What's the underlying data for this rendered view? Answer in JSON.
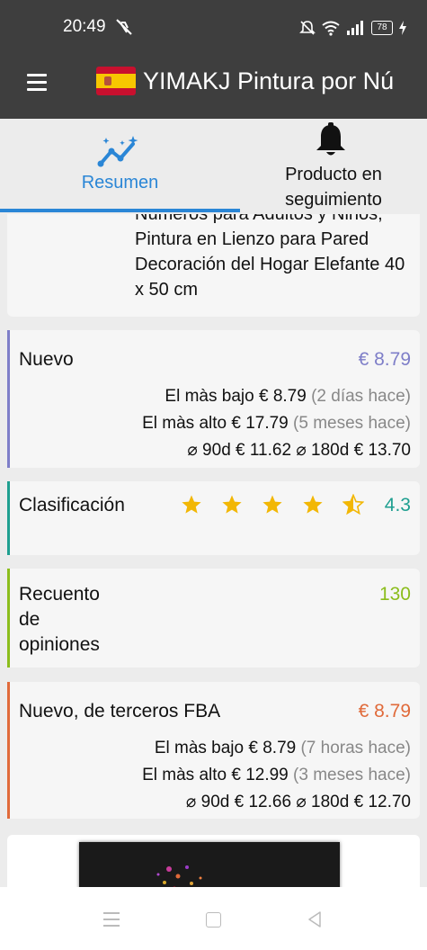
{
  "status_bar": {
    "time": "20:49",
    "battery": "78"
  },
  "app_bar": {
    "title": "YIMAKJ Pintura por Nú"
  },
  "tabs": [
    {
      "label": "Resumen",
      "icon": "chart-sparkle-icon",
      "active": true
    },
    {
      "label": "Producto en seguimiento",
      "icon": "bell-icon",
      "active": false
    }
  ],
  "product": {
    "title_partial": "Números para Adultos y Niños, Pintura en Lienzo para Pared Decoración del Hogar Elefante 40 x 50 cm"
  },
  "nuevo": {
    "label": "Nuevo",
    "price": "€ 8.79",
    "color": "#7e7ec8",
    "low_label": "El màs bajo",
    "low_price": "€ 8.79",
    "low_when": "(2 días hace)",
    "high_label": "El màs alto",
    "high_price": "€ 17.79",
    "high_when": "(5 meses hace)",
    "avg90_label": "⌀ 90d",
    "avg90": "€ 11.62",
    "avg180_label": "⌀ 180d",
    "avg180": "€ 13.70"
  },
  "rating": {
    "label": "Clasificación",
    "value": "4.3",
    "stars": 4.3,
    "color": "#1f9f90"
  },
  "reviews": {
    "label": "Recuento de opiniones",
    "value": "130",
    "color": "#8bbd1c"
  },
  "fba": {
    "label": "Nuevo, de terceros FBA",
    "price": "€ 8.79",
    "color": "#e06a3a",
    "low_label": "El màs bajo",
    "low_price": "€ 8.79",
    "low_when": "(7 horas hace)",
    "high_label": "El màs alto",
    "high_price": "€ 12.99",
    "high_when": "(3 meses hace)",
    "avg90_label": "⌀ 90d",
    "avg90": "€ 12.66",
    "avg180_label": "⌀ 180d",
    "avg180": "€ 12.70"
  }
}
